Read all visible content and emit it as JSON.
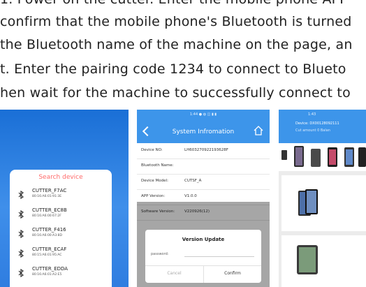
{
  "instructions": [
    "1. Power on the cutter. Enter the mobile phone APP",
    "confirm that the mobile phone's Bluetooth is turned",
    "the Bluetooth name of the machine on the page, an",
    "t. Enter the pairing code 1234 to connect to Blueto",
    "hen wait for the machine to successfully connect to"
  ],
  "bluetooth_panel": {
    "title": "Search device",
    "devices": [
      {
        "name": "CUTTER_F7AC",
        "mac": "80:16:A6:01:91:3E"
      },
      {
        "name": "CUTTER_EC8B",
        "mac": "80:16:A6:00:67:2F"
      },
      {
        "name": "CUTTER_F416",
        "mac": "80:16:A6:00:A3:8D"
      },
      {
        "name": "CUTTER_ECAF",
        "mac": "80:15:A6:01:95:AC"
      },
      {
        "name": "CUTTER_EDDA",
        "mac": "80:16:A6:01:A2:E5"
      }
    ]
  },
  "system_info": {
    "status": "1:44",
    "title": "System Infromation",
    "rows": [
      {
        "label": "Device NO:",
        "value": "LH603270922193628F"
      },
      {
        "label": "Bluetooth Name:",
        "value": ""
      },
      {
        "label": "Device Model:",
        "value": "CUTSF_A"
      },
      {
        "label": "APP Version:",
        "value": "V1.0.0"
      },
      {
        "label": "Software Version:",
        "value": "V220926(12)"
      }
    ],
    "dialog": {
      "title": "Version Update",
      "password_label": "password:",
      "cancel": "Cancel",
      "confirm": "Confirm"
    }
  },
  "device_panel": {
    "status": "1:43",
    "device": "Device: DX00128092111",
    "cut_amount": "Cut amount    0    Balan"
  },
  "colors": {
    "accent": "#3d95ea",
    "title_red": "#ff6b6b"
  }
}
